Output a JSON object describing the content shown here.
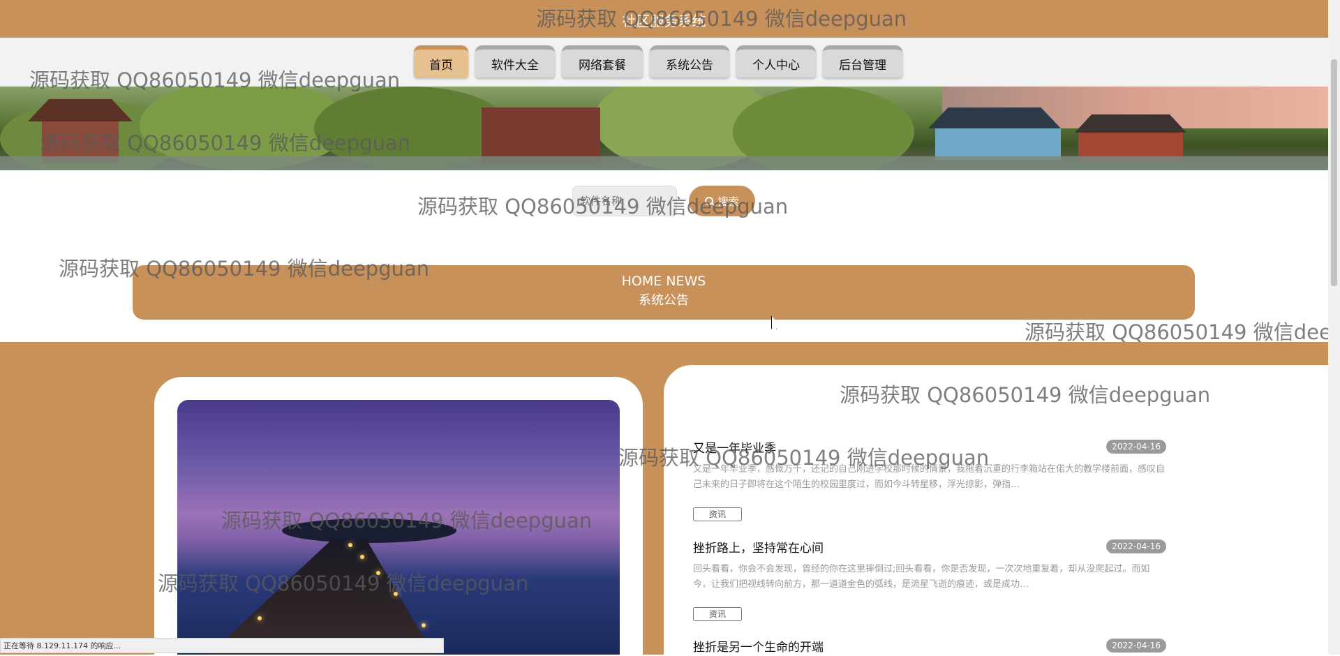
{
  "header": {
    "site_title": "社区服务系统"
  },
  "nav": {
    "items": [
      {
        "label": "首页"
      },
      {
        "label": "软件大全"
      },
      {
        "label": "网络套餐"
      },
      {
        "label": "系统公告"
      },
      {
        "label": "个人中心"
      },
      {
        "label": "后台管理"
      }
    ],
    "active_index": 0
  },
  "search": {
    "placeholder": "软件名称",
    "button_label": "搜索"
  },
  "news_section": {
    "title_en": "HOME NEWS",
    "title_cn": "系统公告"
  },
  "news": [
    {
      "title": "又是一年毕业季",
      "date": "2022-04-16",
      "summary": "又是一年毕业季，感慨万千，还记的自己刚进学校那时候的情景，我拖着沉重的行李箱站在偌大的教学楼前面，感叹自己未来的日子即将在这个陌生的校园里度过，而如今斗转星移，浮光掠影，弹指…",
      "tag": "资讯"
    },
    {
      "title": "挫折路上，坚持常在心间",
      "date": "2022-04-16",
      "summary": "回头看看，你会不会发现，曾经的你在这里摔倒过;回头看看，你是否发现，一次次地重复着，却从没爬起过。而如今，让我们把视线转向前方，那一道道金色的弧线，是流星飞逝的痕迹，或是成功…",
      "tag": "资讯"
    },
    {
      "title": "挫折是另一个生命的开端",
      "date": "2022-04-16"
    }
  ],
  "watermark": {
    "text": "源码获取 QQ86050149 微信deepguan"
  },
  "statusbar": {
    "text": "正在等待 8.129.11.174 的响应..."
  },
  "colors": {
    "accent": "#c9915a",
    "nav_active": "#e6c08f",
    "date_badge": "#9a9a9a"
  }
}
